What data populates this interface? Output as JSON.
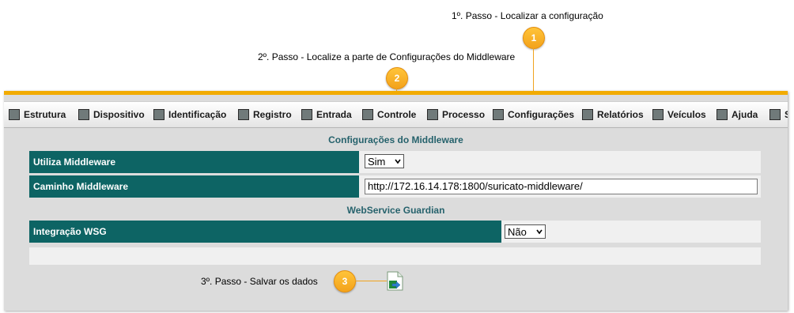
{
  "annotations": {
    "step1": "1º. Passo - Localizar a configuração",
    "step2": "2º. Passo - Localize a parte de Configurações do Middleware",
    "step3": "3º. Passo - Salvar os dados",
    "badge1": "1",
    "badge2": "2",
    "badge3": "3",
    "badge_color": "#f3a21b"
  },
  "menu": {
    "items": [
      {
        "label": "Estrutura",
        "icon": "structure-icon"
      },
      {
        "label": "Dispositivo",
        "icon": "device-icon"
      },
      {
        "label": "Identificação",
        "icon": "people-icon"
      },
      {
        "label": "Registro",
        "icon": "register-icon"
      },
      {
        "label": "Entrada",
        "icon": "entry-icon"
      },
      {
        "label": "Controle",
        "icon": "control-icon"
      },
      {
        "label": "Processo",
        "icon": "tools-icon"
      },
      {
        "label": "Configurações",
        "icon": "settings-stack-icon"
      },
      {
        "label": "Relatórios",
        "icon": "lock-report-icon"
      },
      {
        "label": "Veículos",
        "icon": "vehicle-icon"
      },
      {
        "label": "Ajuda",
        "icon": "help-icon"
      },
      {
        "label": "S",
        "icon": "more-icon"
      }
    ],
    "accent_color": "#f2ab00"
  },
  "middleware": {
    "title": "Configurações do Middleware",
    "utiliza_label": "Utiliza Middleware",
    "utiliza_value": "Sim",
    "caminho_label": "Caminho Middleware",
    "caminho_value": "http://172.16.14.178:1800/suricato-middleware/"
  },
  "wsg": {
    "title": "WebService Guardian",
    "integracao_label": "Integração WSG",
    "integracao_value": "Não"
  },
  "colors": {
    "label_bg": "#0d6464",
    "section_title": "#26626c"
  }
}
